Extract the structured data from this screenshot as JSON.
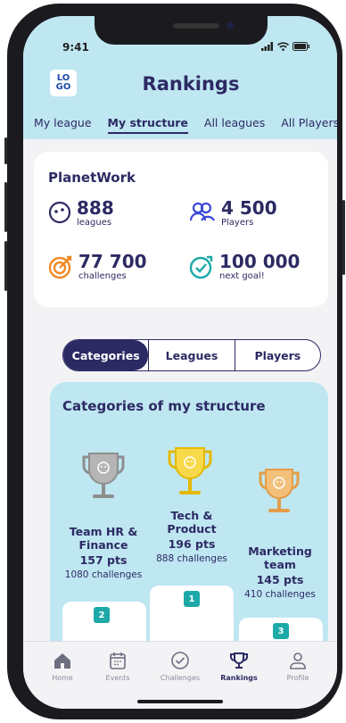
{
  "status": {
    "time": "9:41"
  },
  "app": {
    "logo_top": "LO",
    "logo_bottom": "GO",
    "title": "Rankings"
  },
  "tabs": [
    {
      "label": "My league"
    },
    {
      "label": "My structure"
    },
    {
      "label": "All leagues"
    },
    {
      "label": "All Players"
    }
  ],
  "summary": {
    "company": "PlanetWork",
    "stats": [
      {
        "value": "888",
        "label": "leagues",
        "icon": "smile-icon",
        "color": "#2c2a63"
      },
      {
        "value": "4 500",
        "label": "Players",
        "icon": "players-icon",
        "color": "#3a49d6"
      },
      {
        "value": "77 700",
        "label": "challenges",
        "icon": "target-icon",
        "color": "#f08a24"
      },
      {
        "value": "100 000",
        "label": "next goal!",
        "icon": "goal-check-icon",
        "color": "#1ca9a8"
      }
    ]
  },
  "segments": [
    {
      "label": "Categories"
    },
    {
      "label": "Leagues"
    },
    {
      "label": "Players"
    }
  ],
  "categories": {
    "title": "Categories of my structure",
    "items": [
      {
        "rank": "2",
        "name_line1": "Team HR &",
        "name_line2": "Finance",
        "points": "157 pts",
        "challenges": "1080 challenges",
        "trophy_color": "#b5b5b5"
      },
      {
        "rank": "1",
        "name_line1": "Tech &",
        "name_line2": "Product",
        "points": "196 pts",
        "challenges": "888 challenges",
        "trophy_color": "#f7d94a"
      },
      {
        "rank": "3",
        "name_line1": "Marketing",
        "name_line2": "team",
        "points": "145 pts",
        "challenges": "410 challenges",
        "trophy_color": "#f2c07a"
      }
    ]
  },
  "nav": [
    {
      "label": "Home",
      "icon": "home-icon"
    },
    {
      "label": "Events",
      "icon": "calendar-icon"
    },
    {
      "label": "Challenges",
      "icon": "check-circle-icon"
    },
    {
      "label": "Rankings",
      "icon": "trophy-icon"
    },
    {
      "label": "Profile",
      "icon": "user-icon"
    }
  ],
  "colors": {
    "primary": "#2c2a63",
    "accent": "#1ca9a8",
    "header_bg": "#bfe7f2"
  }
}
